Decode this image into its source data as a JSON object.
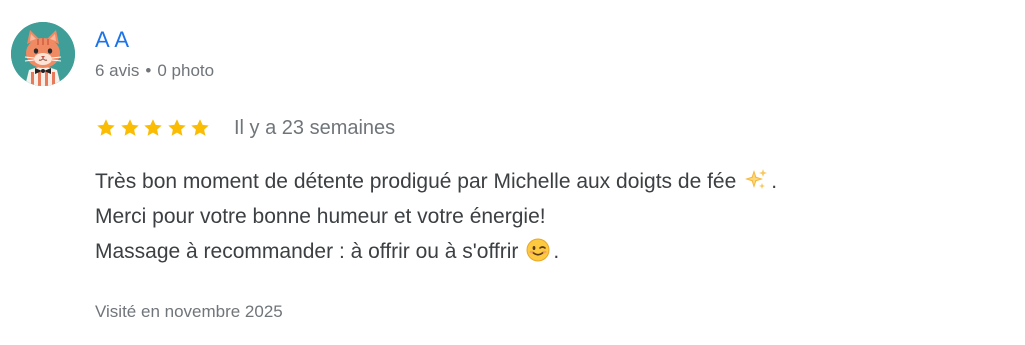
{
  "reviewer": {
    "name": "A A",
    "reviews_count": "6 avis",
    "separator": "•",
    "photos_count": "0 photo",
    "avatar_icon": "cat-avatar-icon"
  },
  "review": {
    "rating": 5,
    "max_rating": 5,
    "star_color": "#fbbc04",
    "date": "Il y a 23 semaines",
    "lines": [
      {
        "text": "Très bon moment de détente prodigué par Michelle aux doigts de fée",
        "emoji": "sparkles-emoji",
        "suffix": "."
      },
      {
        "text": "Merci pour votre bonne humeur et votre énergie!"
      },
      {
        "text": "Massage à recommander : à offrir ou à s'offrir",
        "emoji": "winking-face-emoji",
        "suffix": "."
      }
    ],
    "visited": "Visité en novembre 2025"
  },
  "colors": {
    "link": "#1a73e8",
    "secondary_text": "#70757a",
    "body_text": "#3c4043",
    "avatar_bg": "#3f9e98"
  }
}
